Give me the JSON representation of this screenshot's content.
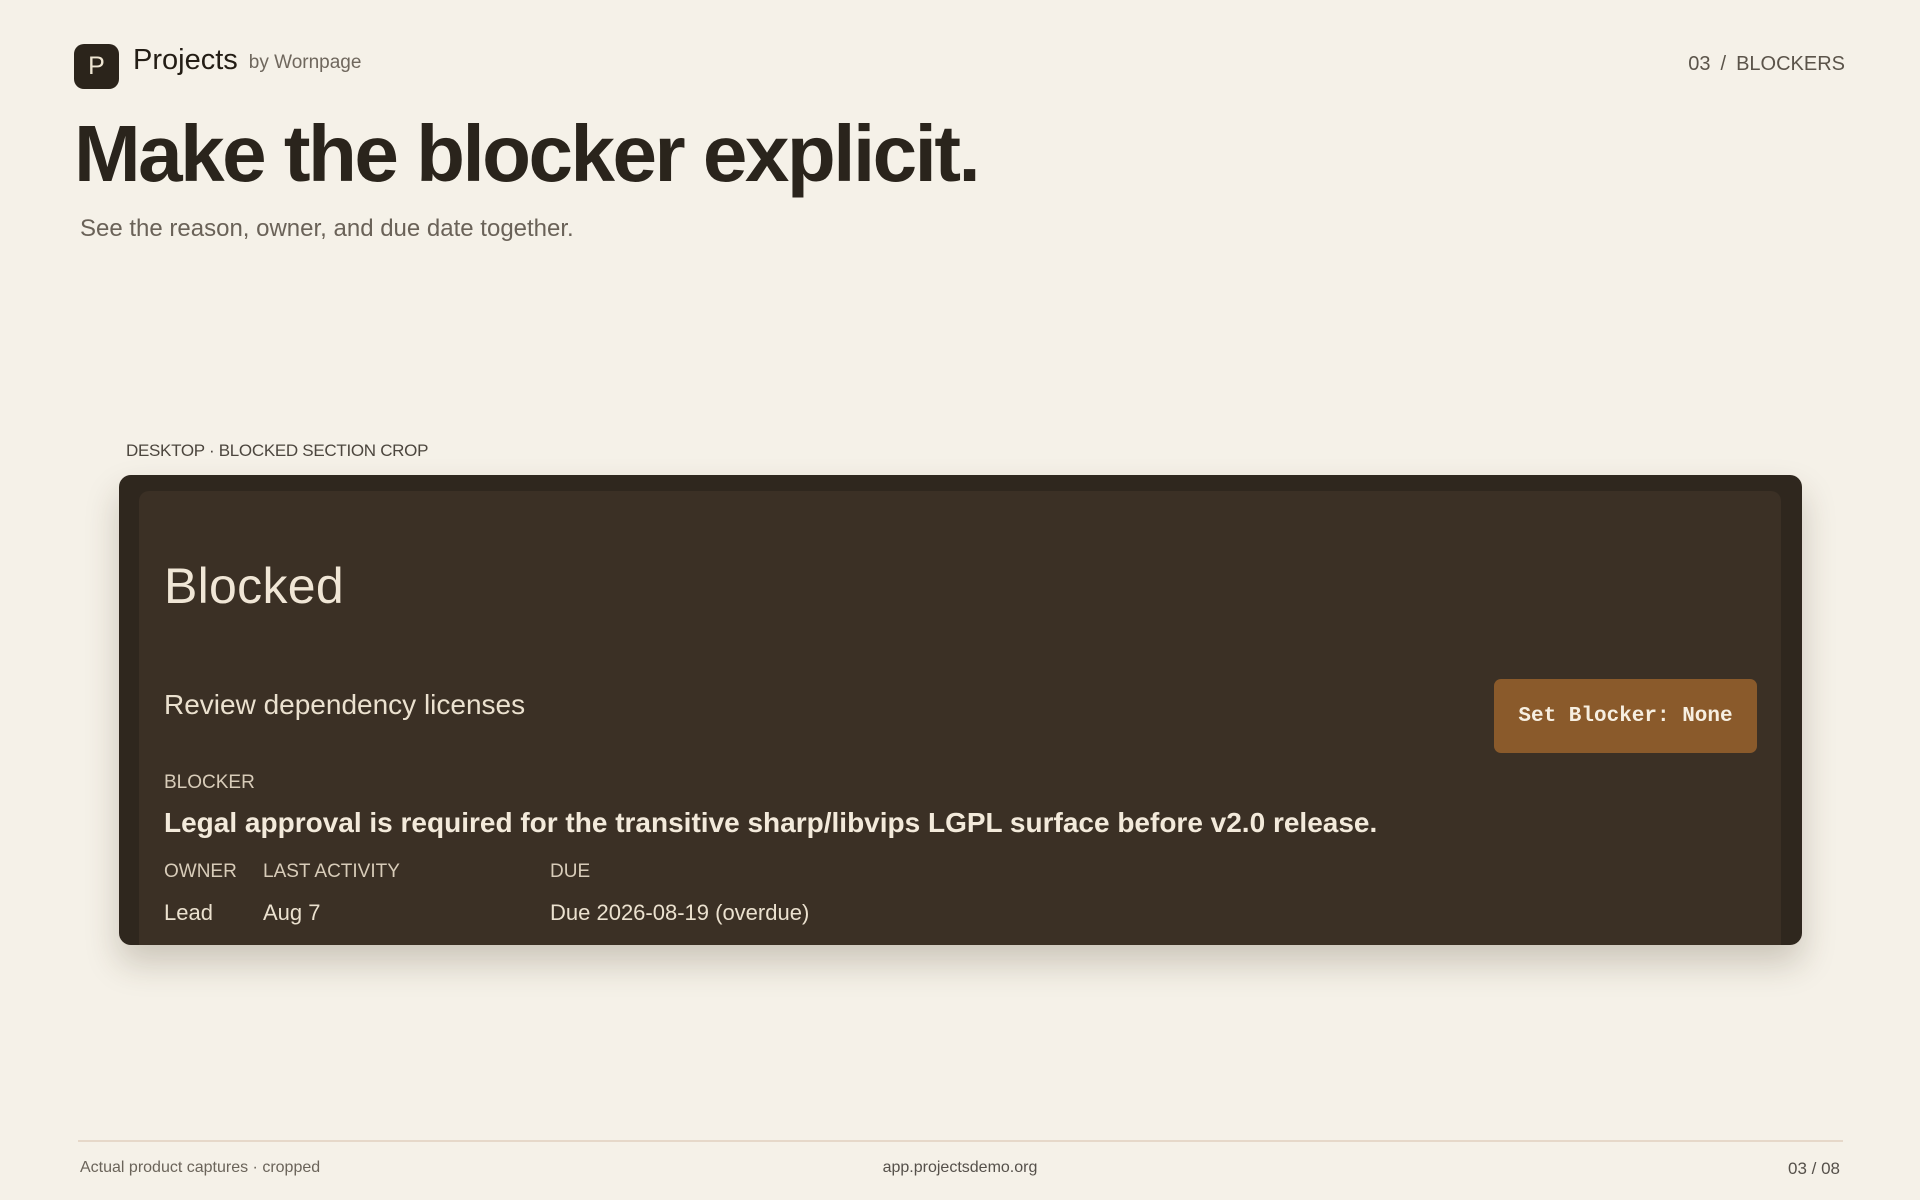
{
  "header": {
    "logo_letter": "P",
    "app_name": "Projects",
    "by_line": "by Wornpage",
    "section_number": "03",
    "separator": "/",
    "section_name": "BLOCKERS"
  },
  "hero": {
    "headline": "Make the blocker explicit.",
    "subhead": "See the reason, owner, and due date together."
  },
  "capture": {
    "label": "DESKTOP · BLOCKED SECTION CROP",
    "panel_title": "Blocked",
    "task_title": "Review dependency licenses",
    "button_label": "Set Blocker: None",
    "blocker_label": "BLOCKER",
    "blocker_text": "Legal approval is required for the transitive sharp/libvips LGPL surface before v2.0 release.",
    "owner_label": "OWNER",
    "owner_value": "Lead",
    "activity_label": "LAST ACTIVITY",
    "activity_value": "Aug 7",
    "due_label": "DUE",
    "due_value": "Due 2026-08-19 (overdue)"
  },
  "footer": {
    "left": "Actual product captures · cropped",
    "center": "app.projectsdemo.org",
    "right": "03 / 08"
  }
}
